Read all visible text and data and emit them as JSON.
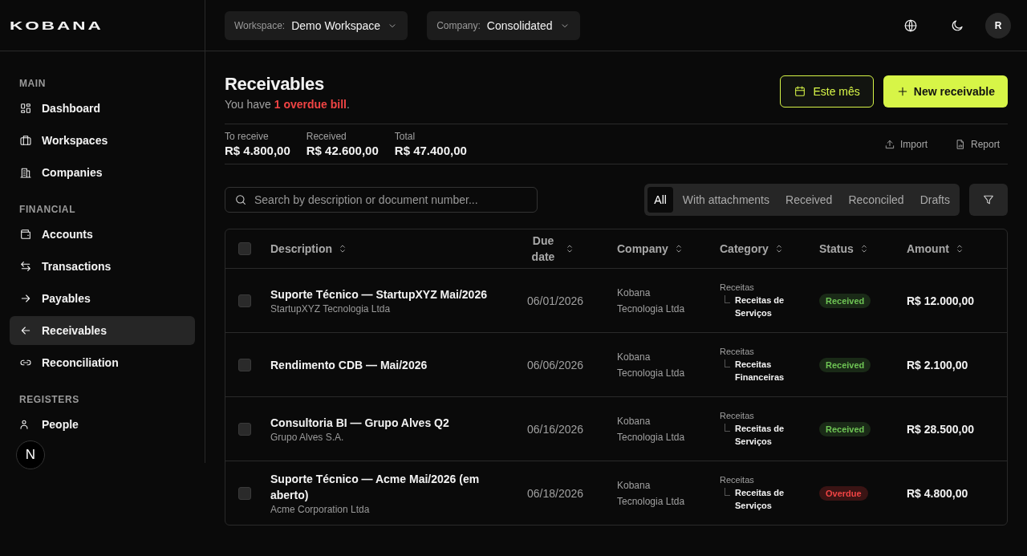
{
  "logo": "KOBANA",
  "topbar": {
    "selectors": [
      {
        "label": "Workspace:",
        "value": "Demo Workspace"
      },
      {
        "label": "Company:",
        "value": "Consolidated"
      }
    ],
    "avatar": "R"
  },
  "sidebar": {
    "sections": [
      {
        "title": "MAIN",
        "items": [
          {
            "label": "Dashboard",
            "selected": false
          },
          {
            "label": "Workspaces",
            "selected": false
          },
          {
            "label": "Companies",
            "selected": false
          }
        ]
      },
      {
        "title": "FINANCIAL",
        "items": [
          {
            "label": "Accounts",
            "selected": false
          },
          {
            "label": "Transactions",
            "selected": false
          },
          {
            "label": "Payables",
            "selected": false
          },
          {
            "label": "Receivables",
            "selected": true
          },
          {
            "label": "Reconciliation",
            "selected": false
          }
        ]
      },
      {
        "title": "REGISTERS",
        "items": [
          {
            "label": "People",
            "selected": false
          }
        ]
      }
    ]
  },
  "dev_indicator": "N",
  "page": {
    "title": "Receivables",
    "subtitle": "You have **1 overdue bill**.",
    "period_button": "Este mês",
    "primary_button": "New receivable",
    "summary": [
      {
        "label": "To receive",
        "value": "R$ 4.800,00"
      },
      {
        "label": "Received",
        "value": "R$ 42.600,00"
      },
      {
        "label": "Total",
        "value": "R$ 47.400,00"
      }
    ],
    "actions": [
      "Import",
      "Report"
    ],
    "search": {
      "placeholder": "Search by description or document number..."
    },
    "tabs": [
      {
        "label": "All",
        "selected": true
      },
      {
        "label": "With attachments",
        "selected": false
      },
      {
        "label": "Received",
        "selected": false
      },
      {
        "label": "Reconciled",
        "selected": false
      },
      {
        "label": "Drafts",
        "selected": false
      }
    ]
  },
  "table": {
    "select_all": {
      "checked": false
    },
    "columns": [
      "Description",
      "Due date",
      "Company",
      "Category",
      "Status",
      "Amount"
    ],
    "rows": [
      {
        "checked": false,
        "description": "Suporte Técnico — StartupXYZ Mai/2026",
        "customer": "StartupXYZ Tecnologia Ltda",
        "due_date": "06/01/2026",
        "company": "Kobana Tecnologia Ltda",
        "category_parent": "Receitas",
        "category": "Receitas de Serviços",
        "status": {
          "label": "Received",
          "kind": "received"
        },
        "amount": "R$ 12.000,00"
      },
      {
        "checked": false,
        "description": "Rendimento CDB — Mai/2026",
        "due_date": "06/06/2026",
        "company": "Kobana Tecnologia Ltda",
        "category_parent": "Receitas",
        "category": "Receitas Financeiras",
        "status": {
          "label": "Received",
          "kind": "received"
        },
        "amount": "R$ 2.100,00"
      },
      {
        "checked": false,
        "description": "Consultoria BI — Grupo Alves Q2",
        "customer": "Grupo Alves S.A.",
        "due_date": "06/16/2026",
        "company": "Kobana Tecnologia Ltda",
        "category_parent": "Receitas",
        "category": "Receitas de Serviços",
        "status": {
          "label": "Received",
          "kind": "received"
        },
        "amount": "R$ 28.500,00"
      },
      {
        "checked": false,
        "description": "Suporte Técnico — Acme Mai/2026 (em aberto)",
        "customer": "Acme Corporation Ltda",
        "due_date": "06/18/2026",
        "company": "Kobana Tecnologia Ltda",
        "category_parent": "Receitas",
        "category": "Receitas de Serviços",
        "status": {
          "label": "Overdue",
          "kind": "overdue"
        },
        "amount": "R$ 4.800,00"
      }
    ]
  }
}
